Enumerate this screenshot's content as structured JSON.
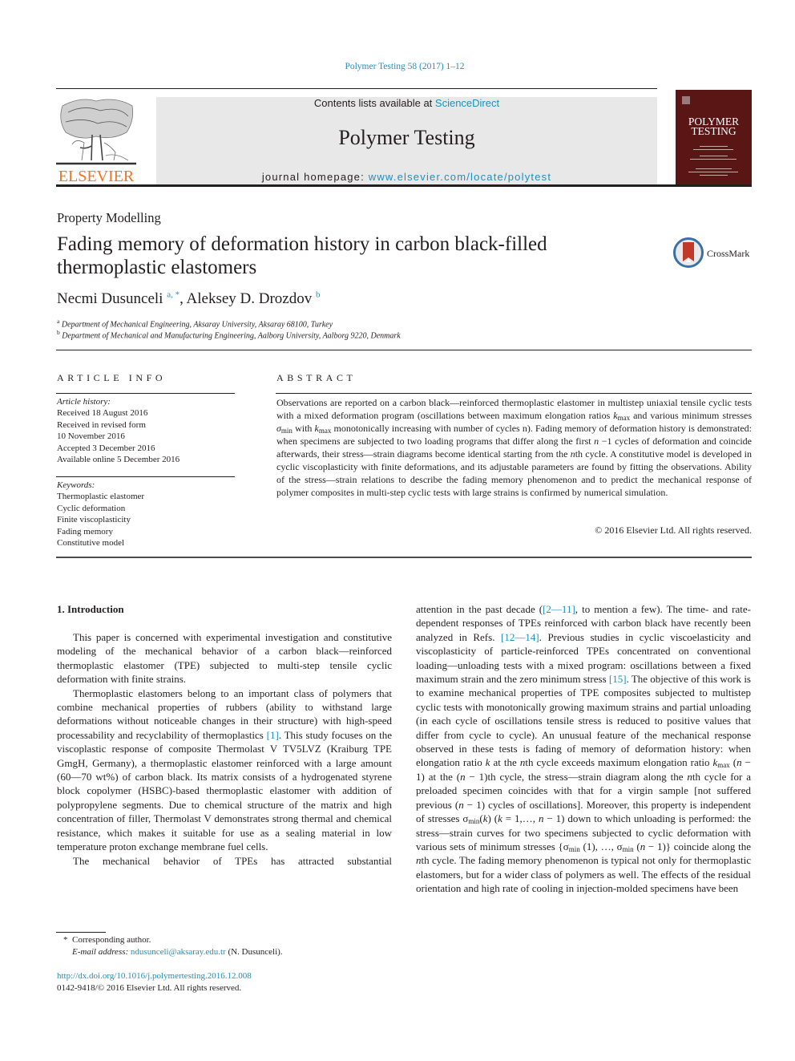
{
  "header": {
    "citation": "Polymer Testing 58 (2017) 1–12",
    "contents_prefix": "Contents lists available at ",
    "contents_link": "ScienceDirect",
    "journal_title": "Polymer Testing",
    "homepage_prefix": "journal homepage: ",
    "homepage_link": "www.elsevier.com/locate/polytest",
    "publisher_logo_text": "ELSEVIER",
    "cover_title_line1": "POLYMER",
    "cover_title_line2": "TESTING",
    "crossmark_label": "CrossMark"
  },
  "colors": {
    "link": "#1f8fc0",
    "elsevier_orange": "#f37321",
    "cover_maroon": "#5a1515",
    "journal_box_gray": "#e8e8e8",
    "crossmark_red": "#c0392b"
  },
  "article": {
    "section": "Property Modelling",
    "title_line1": "Fading memory of deformation history in carbon black-filled",
    "title_line2": "thermoplastic elastomers",
    "authors": [
      {
        "name": "Necmi Dusunceli",
        "aff": "a, *"
      },
      {
        "name": "Aleksey D. Drozdov",
        "aff": "b"
      }
    ],
    "author_separator": ", ",
    "affiliations": [
      {
        "mark": "a",
        "text": "Department of Mechanical Engineering, Aksaray University, Aksaray 68100, Turkey"
      },
      {
        "mark": "b",
        "text": "Department of Mechanical and Manufacturing Engineering, Aalborg University, Aalborg 9220, Denmark"
      }
    ]
  },
  "article_info": {
    "heading": "ARTICLE INFO",
    "history_label": "Article history:",
    "history": [
      "Received 18 August 2016",
      "Received in revised form",
      "10 November 2016",
      "Accepted 3 December 2016",
      "Available online 5 December 2016"
    ],
    "keywords_label": "Keywords:",
    "keywords": [
      "Thermoplastic elastomer",
      "Cyclic deformation",
      "Finite viscoplasticity",
      "Fading memory",
      "Constitutive model"
    ]
  },
  "abstract": {
    "heading": "ABSTRACT",
    "p1": "Observations are reported on a carbon black—reinforced thermoplastic elastomer in multistep uniaxial tensile cyclic tests with a mixed deformation program (oscillations between maximum elongation ratios ",
    "k": "k",
    "max": "max",
    "p2": " and various minimum stresses ",
    "sigma": "σ",
    "min": "min",
    "p3": " with ",
    "p4": " monotonically increasing with number of cycles n). Fading memory of deformation history is demonstrated: when specimens are subjected to two loading programs that differ along the first ",
    "n": "n",
    "p5": " −1 cycles of deformation and coincide afterwards, their stress—strain diagrams become identical starting from the ",
    "p6": "th cycle. A constitutive model is developed in cyclic viscoplasticity with finite deformations, and its adjustable parameters are found by fitting the observations. Ability of the stress—strain relations to describe the fading memory phenomenon and to predict the mechanical response of polymer composites in multi-step cyclic tests with large strains is confirmed by numerical simulation.",
    "copyright": "© 2016 Elsevier Ltd. All rights reserved."
  },
  "body": {
    "intro_heading": "1.  Introduction",
    "left": {
      "para1": "This paper is concerned with experimental investigation and constitutive modeling of the mechanical behavior of a carbon black—reinforced thermoplastic elastomer (TPE) subjected to multi-step tensile cyclic deformation with finite strains.",
      "para2a": "Thermoplastic elastomers belong to an important class of polymers that combine mechanical properties of rubbers (ability to withstand large deformations without noticeable changes in their structure) with high-speed processability and recyclability of thermoplastics ",
      "ref1": "[1]",
      "para2b": ". This study focuses on the viscoplastic response of composite Thermolast V TV5LVZ (Kraiburg TPE GmgH, Germany), a thermoplastic elastomer reinforced with a large amount (60—70 wt%) of carbon black. Its matrix consists of a hydrogenated styrene block copolymer (HSBC)-based thermoplastic elastomer with addition of polypropylene segments. Due to chemical structure of the matrix and high concentration of filler, Thermolast V demonstrates strong thermal and chemical resistance, which makes it suitable for use as a sealing material in low temperature proton exchange membrane fuel cells.",
      "para3": "The mechanical behavior of TPEs has attracted substantial"
    },
    "right": {
      "t1": "attention in the past decade (",
      "ref2": "[2—11]",
      "t2": ", to mention a few). The time- and rate-dependent responses of TPEs reinforced with carbon black have recently been analyzed in Refs. ",
      "ref3": "[12—14]",
      "t3": ". Previous studies in cyclic viscoelasticity and viscoplasticity of particle-reinforced TPEs concentrated on conventional loading—unloading tests with a mixed program: oscillations between a fixed maximum strain and the zero minimum stress ",
      "ref4": "[15]",
      "t4": ". The objective of this work is to examine mechanical properties of TPE composites subjected to multistep cyclic tests with monotonically growing maximum strains and partial unloading (in each cycle of oscillations tensile stress is reduced to positive values that differ from cycle to cycle). An unusual feature of the mechanical response observed in these tests is fading of memory of deformation history: when elongation ratio ",
      "k": "k",
      "t5": " at the ",
      "n": "n",
      "t6": "th cycle exceeds maximum elongation ratio ",
      "max": "max",
      "t7": " (",
      "t8": " − 1) at the (",
      "t9": " − 1)th cycle, the stress—strain diagram along the ",
      "t10": "th cycle for a preloaded specimen coincides with that for a virgin sample [not suffered previous (",
      "t11": " − 1) cycles of oscillations]. Moreover, this property is independent of stresses σ",
      "min": "min",
      "t12": "(",
      "t13": ") (",
      "t14": " = 1,…, ",
      "t15": " − 1) down to which unloading is performed: the stress—strain curves for two specimens subjected to cyclic deformation with various sets of minimum stresses {σ",
      "t16": " (1), …, σ",
      "t17": " (",
      "t18": " − 1)} coincide along the ",
      "t19": "th cycle. The fading memory phenomenon is typical not only for thermoplastic elastomers, but for a wider class of polymers as well. The effects of the residual orientation and high rate of cooling in injection-molded specimens have been"
    }
  },
  "footnotes": {
    "corresponding_mark": "*",
    "corresponding": "Corresponding author.",
    "email_label": "E-mail address: ",
    "email": "ndusunceli@aksaray.edu.tr",
    "email_suffix": " (N. Dusunceli).",
    "doi": "http://dx.doi.org/10.1016/j.polymertesting.2016.12.008",
    "issn": "0142-9418/© 2016 Elsevier Ltd. All rights reserved."
  }
}
